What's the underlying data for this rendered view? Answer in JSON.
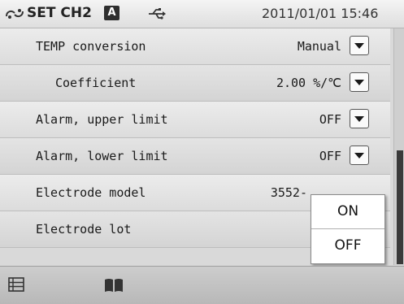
{
  "header": {
    "title": "SET CH2",
    "mode_badge": "A",
    "datetime": "2011/01/01 15:46",
    "icons": [
      "link-icon",
      "usb-icon"
    ]
  },
  "rows": [
    {
      "label": "TEMP conversion",
      "value": "Manual"
    },
    {
      "label": "Coefficient",
      "value": "2.00 %/℃"
    },
    {
      "label": "Alarm, upper limit",
      "value": "OFF"
    },
    {
      "label": "Alarm, lower limit",
      "value": "OFF"
    },
    {
      "label": "Electrode model",
      "value": "3552-"
    },
    {
      "label": "Electrode lot",
      "value": ""
    }
  ],
  "popup": {
    "options": [
      "ON",
      "OFF"
    ]
  },
  "footer": {
    "icons": [
      "list-icon",
      "book-icon"
    ]
  }
}
